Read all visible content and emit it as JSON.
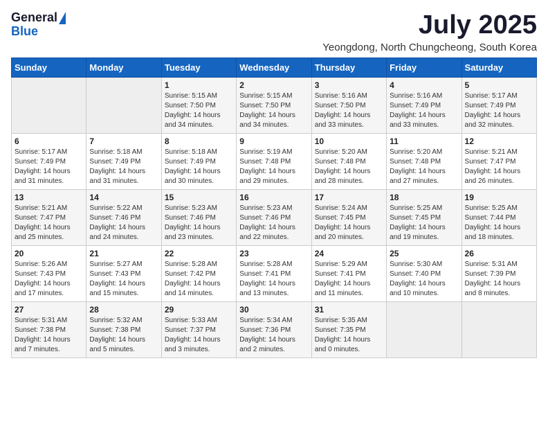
{
  "logo": {
    "general": "General",
    "blue": "Blue"
  },
  "title": "July 2025",
  "subtitle": "Yeongdong, North Chungcheong, South Korea",
  "weekdays": [
    "Sunday",
    "Monday",
    "Tuesday",
    "Wednesday",
    "Thursday",
    "Friday",
    "Saturday"
  ],
  "weeks": [
    [
      {
        "day": "",
        "sunrise": "",
        "sunset": "",
        "daylight": ""
      },
      {
        "day": "",
        "sunrise": "",
        "sunset": "",
        "daylight": ""
      },
      {
        "day": "1",
        "sunrise": "Sunrise: 5:15 AM",
        "sunset": "Sunset: 7:50 PM",
        "daylight": "Daylight: 14 hours and 34 minutes."
      },
      {
        "day": "2",
        "sunrise": "Sunrise: 5:15 AM",
        "sunset": "Sunset: 7:50 PM",
        "daylight": "Daylight: 14 hours and 34 minutes."
      },
      {
        "day": "3",
        "sunrise": "Sunrise: 5:16 AM",
        "sunset": "Sunset: 7:50 PM",
        "daylight": "Daylight: 14 hours and 33 minutes."
      },
      {
        "day": "4",
        "sunrise": "Sunrise: 5:16 AM",
        "sunset": "Sunset: 7:49 PM",
        "daylight": "Daylight: 14 hours and 33 minutes."
      },
      {
        "day": "5",
        "sunrise": "Sunrise: 5:17 AM",
        "sunset": "Sunset: 7:49 PM",
        "daylight": "Daylight: 14 hours and 32 minutes."
      }
    ],
    [
      {
        "day": "6",
        "sunrise": "Sunrise: 5:17 AM",
        "sunset": "Sunset: 7:49 PM",
        "daylight": "Daylight: 14 hours and 31 minutes."
      },
      {
        "day": "7",
        "sunrise": "Sunrise: 5:18 AM",
        "sunset": "Sunset: 7:49 PM",
        "daylight": "Daylight: 14 hours and 31 minutes."
      },
      {
        "day": "8",
        "sunrise": "Sunrise: 5:18 AM",
        "sunset": "Sunset: 7:49 PM",
        "daylight": "Daylight: 14 hours and 30 minutes."
      },
      {
        "day": "9",
        "sunrise": "Sunrise: 5:19 AM",
        "sunset": "Sunset: 7:48 PM",
        "daylight": "Daylight: 14 hours and 29 minutes."
      },
      {
        "day": "10",
        "sunrise": "Sunrise: 5:20 AM",
        "sunset": "Sunset: 7:48 PM",
        "daylight": "Daylight: 14 hours and 28 minutes."
      },
      {
        "day": "11",
        "sunrise": "Sunrise: 5:20 AM",
        "sunset": "Sunset: 7:48 PM",
        "daylight": "Daylight: 14 hours and 27 minutes."
      },
      {
        "day": "12",
        "sunrise": "Sunrise: 5:21 AM",
        "sunset": "Sunset: 7:47 PM",
        "daylight": "Daylight: 14 hours and 26 minutes."
      }
    ],
    [
      {
        "day": "13",
        "sunrise": "Sunrise: 5:21 AM",
        "sunset": "Sunset: 7:47 PM",
        "daylight": "Daylight: 14 hours and 25 minutes."
      },
      {
        "day": "14",
        "sunrise": "Sunrise: 5:22 AM",
        "sunset": "Sunset: 7:46 PM",
        "daylight": "Daylight: 14 hours and 24 minutes."
      },
      {
        "day": "15",
        "sunrise": "Sunrise: 5:23 AM",
        "sunset": "Sunset: 7:46 PM",
        "daylight": "Daylight: 14 hours and 23 minutes."
      },
      {
        "day": "16",
        "sunrise": "Sunrise: 5:23 AM",
        "sunset": "Sunset: 7:46 PM",
        "daylight": "Daylight: 14 hours and 22 minutes."
      },
      {
        "day": "17",
        "sunrise": "Sunrise: 5:24 AM",
        "sunset": "Sunset: 7:45 PM",
        "daylight": "Daylight: 14 hours and 20 minutes."
      },
      {
        "day": "18",
        "sunrise": "Sunrise: 5:25 AM",
        "sunset": "Sunset: 7:45 PM",
        "daylight": "Daylight: 14 hours and 19 minutes."
      },
      {
        "day": "19",
        "sunrise": "Sunrise: 5:25 AM",
        "sunset": "Sunset: 7:44 PM",
        "daylight": "Daylight: 14 hours and 18 minutes."
      }
    ],
    [
      {
        "day": "20",
        "sunrise": "Sunrise: 5:26 AM",
        "sunset": "Sunset: 7:43 PM",
        "daylight": "Daylight: 14 hours and 17 minutes."
      },
      {
        "day": "21",
        "sunrise": "Sunrise: 5:27 AM",
        "sunset": "Sunset: 7:43 PM",
        "daylight": "Daylight: 14 hours and 15 minutes."
      },
      {
        "day": "22",
        "sunrise": "Sunrise: 5:28 AM",
        "sunset": "Sunset: 7:42 PM",
        "daylight": "Daylight: 14 hours and 14 minutes."
      },
      {
        "day": "23",
        "sunrise": "Sunrise: 5:28 AM",
        "sunset": "Sunset: 7:41 PM",
        "daylight": "Daylight: 14 hours and 13 minutes."
      },
      {
        "day": "24",
        "sunrise": "Sunrise: 5:29 AM",
        "sunset": "Sunset: 7:41 PM",
        "daylight": "Daylight: 14 hours and 11 minutes."
      },
      {
        "day": "25",
        "sunrise": "Sunrise: 5:30 AM",
        "sunset": "Sunset: 7:40 PM",
        "daylight": "Daylight: 14 hours and 10 minutes."
      },
      {
        "day": "26",
        "sunrise": "Sunrise: 5:31 AM",
        "sunset": "Sunset: 7:39 PM",
        "daylight": "Daylight: 14 hours and 8 minutes."
      }
    ],
    [
      {
        "day": "27",
        "sunrise": "Sunrise: 5:31 AM",
        "sunset": "Sunset: 7:38 PM",
        "daylight": "Daylight: 14 hours and 7 minutes."
      },
      {
        "day": "28",
        "sunrise": "Sunrise: 5:32 AM",
        "sunset": "Sunset: 7:38 PM",
        "daylight": "Daylight: 14 hours and 5 minutes."
      },
      {
        "day": "29",
        "sunrise": "Sunrise: 5:33 AM",
        "sunset": "Sunset: 7:37 PM",
        "daylight": "Daylight: 14 hours and 3 minutes."
      },
      {
        "day": "30",
        "sunrise": "Sunrise: 5:34 AM",
        "sunset": "Sunset: 7:36 PM",
        "daylight": "Daylight: 14 hours and 2 minutes."
      },
      {
        "day": "31",
        "sunrise": "Sunrise: 5:35 AM",
        "sunset": "Sunset: 7:35 PM",
        "daylight": "Daylight: 14 hours and 0 minutes."
      },
      {
        "day": "",
        "sunrise": "",
        "sunset": "",
        "daylight": ""
      },
      {
        "day": "",
        "sunrise": "",
        "sunset": "",
        "daylight": ""
      }
    ]
  ]
}
